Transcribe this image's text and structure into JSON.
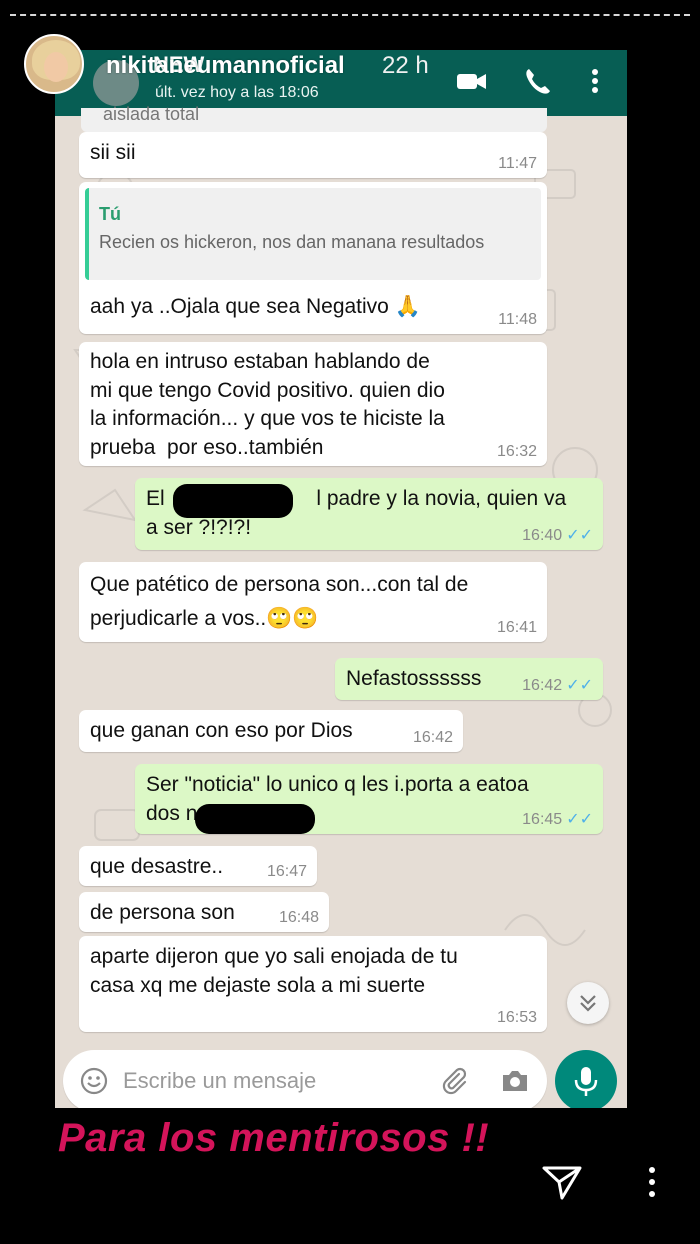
{
  "story": {
    "username": "nikitaneumannoficial",
    "time_ago": "22 h",
    "caption": "Para los mentirosos !!"
  },
  "chat": {
    "last_seen": "últ. vez hoy a las 18:06",
    "cut_off_quote": "aislada total",
    "messages": [
      {
        "dir": "in",
        "text": "sii  sii",
        "time": "11:47"
      },
      {
        "dir": "in",
        "quote_author": "Tú",
        "quote_text": "Recien  os hickeron, nos dan manana resultados",
        "text": "aah ya ..Ojala que sea Negativo 🙏",
        "time": "11:48"
      },
      {
        "dir": "in",
        "text": "hola en intruso estaban hablando de\nmi que tengo Covid positivo. quien dio\nla información... y que vos te hiciste la\nprueba  por eso..también",
        "time": "16:32"
      },
      {
        "dir": "out",
        "text": "El                          l padre y la novia, quien va\na ser ?!?!?!",
        "time": "16:40"
      },
      {
        "dir": "in",
        "text": "Que patético de persona son...con tal de\nperjudicarle a vos..🙄🙄",
        "time": "16:41"
      },
      {
        "dir": "out",
        "text": "Nefastossssss",
        "time": "16:42"
      },
      {
        "dir": "in",
        "text": "que ganan con eso por Dios",
        "time": "16:42"
      },
      {
        "dir": "out",
        "text": "Ser \"noticia\" lo unico q les i.porta a eatoa\ndos n",
        "time": "16:45"
      },
      {
        "dir": "in",
        "text": "que desastre..",
        "time": "16:47"
      },
      {
        "dir": "in",
        "text": "de persona son",
        "time": "16:48"
      },
      {
        "dir": "in",
        "text": "aparte dijeron que yo sali enojada de tu\ncasa xq me dejaste sola a mi suerte",
        "time": "16:53"
      }
    ],
    "read_ticks": "✓✓",
    "input_placeholder": "Escribe un mensaje"
  },
  "colors": {
    "header": "#075e54",
    "outgoing": "#dcf8c6",
    "incoming": "#ffffff",
    "caption": "#d4145a",
    "mic": "#00897b"
  },
  "icons": [
    "video-call-icon",
    "phone-call-icon",
    "more-vert-icon",
    "emoji-icon",
    "attach-icon",
    "camera-icon",
    "mic-icon",
    "scroll-down-icon",
    "send-icon",
    "story-more-icon"
  ]
}
